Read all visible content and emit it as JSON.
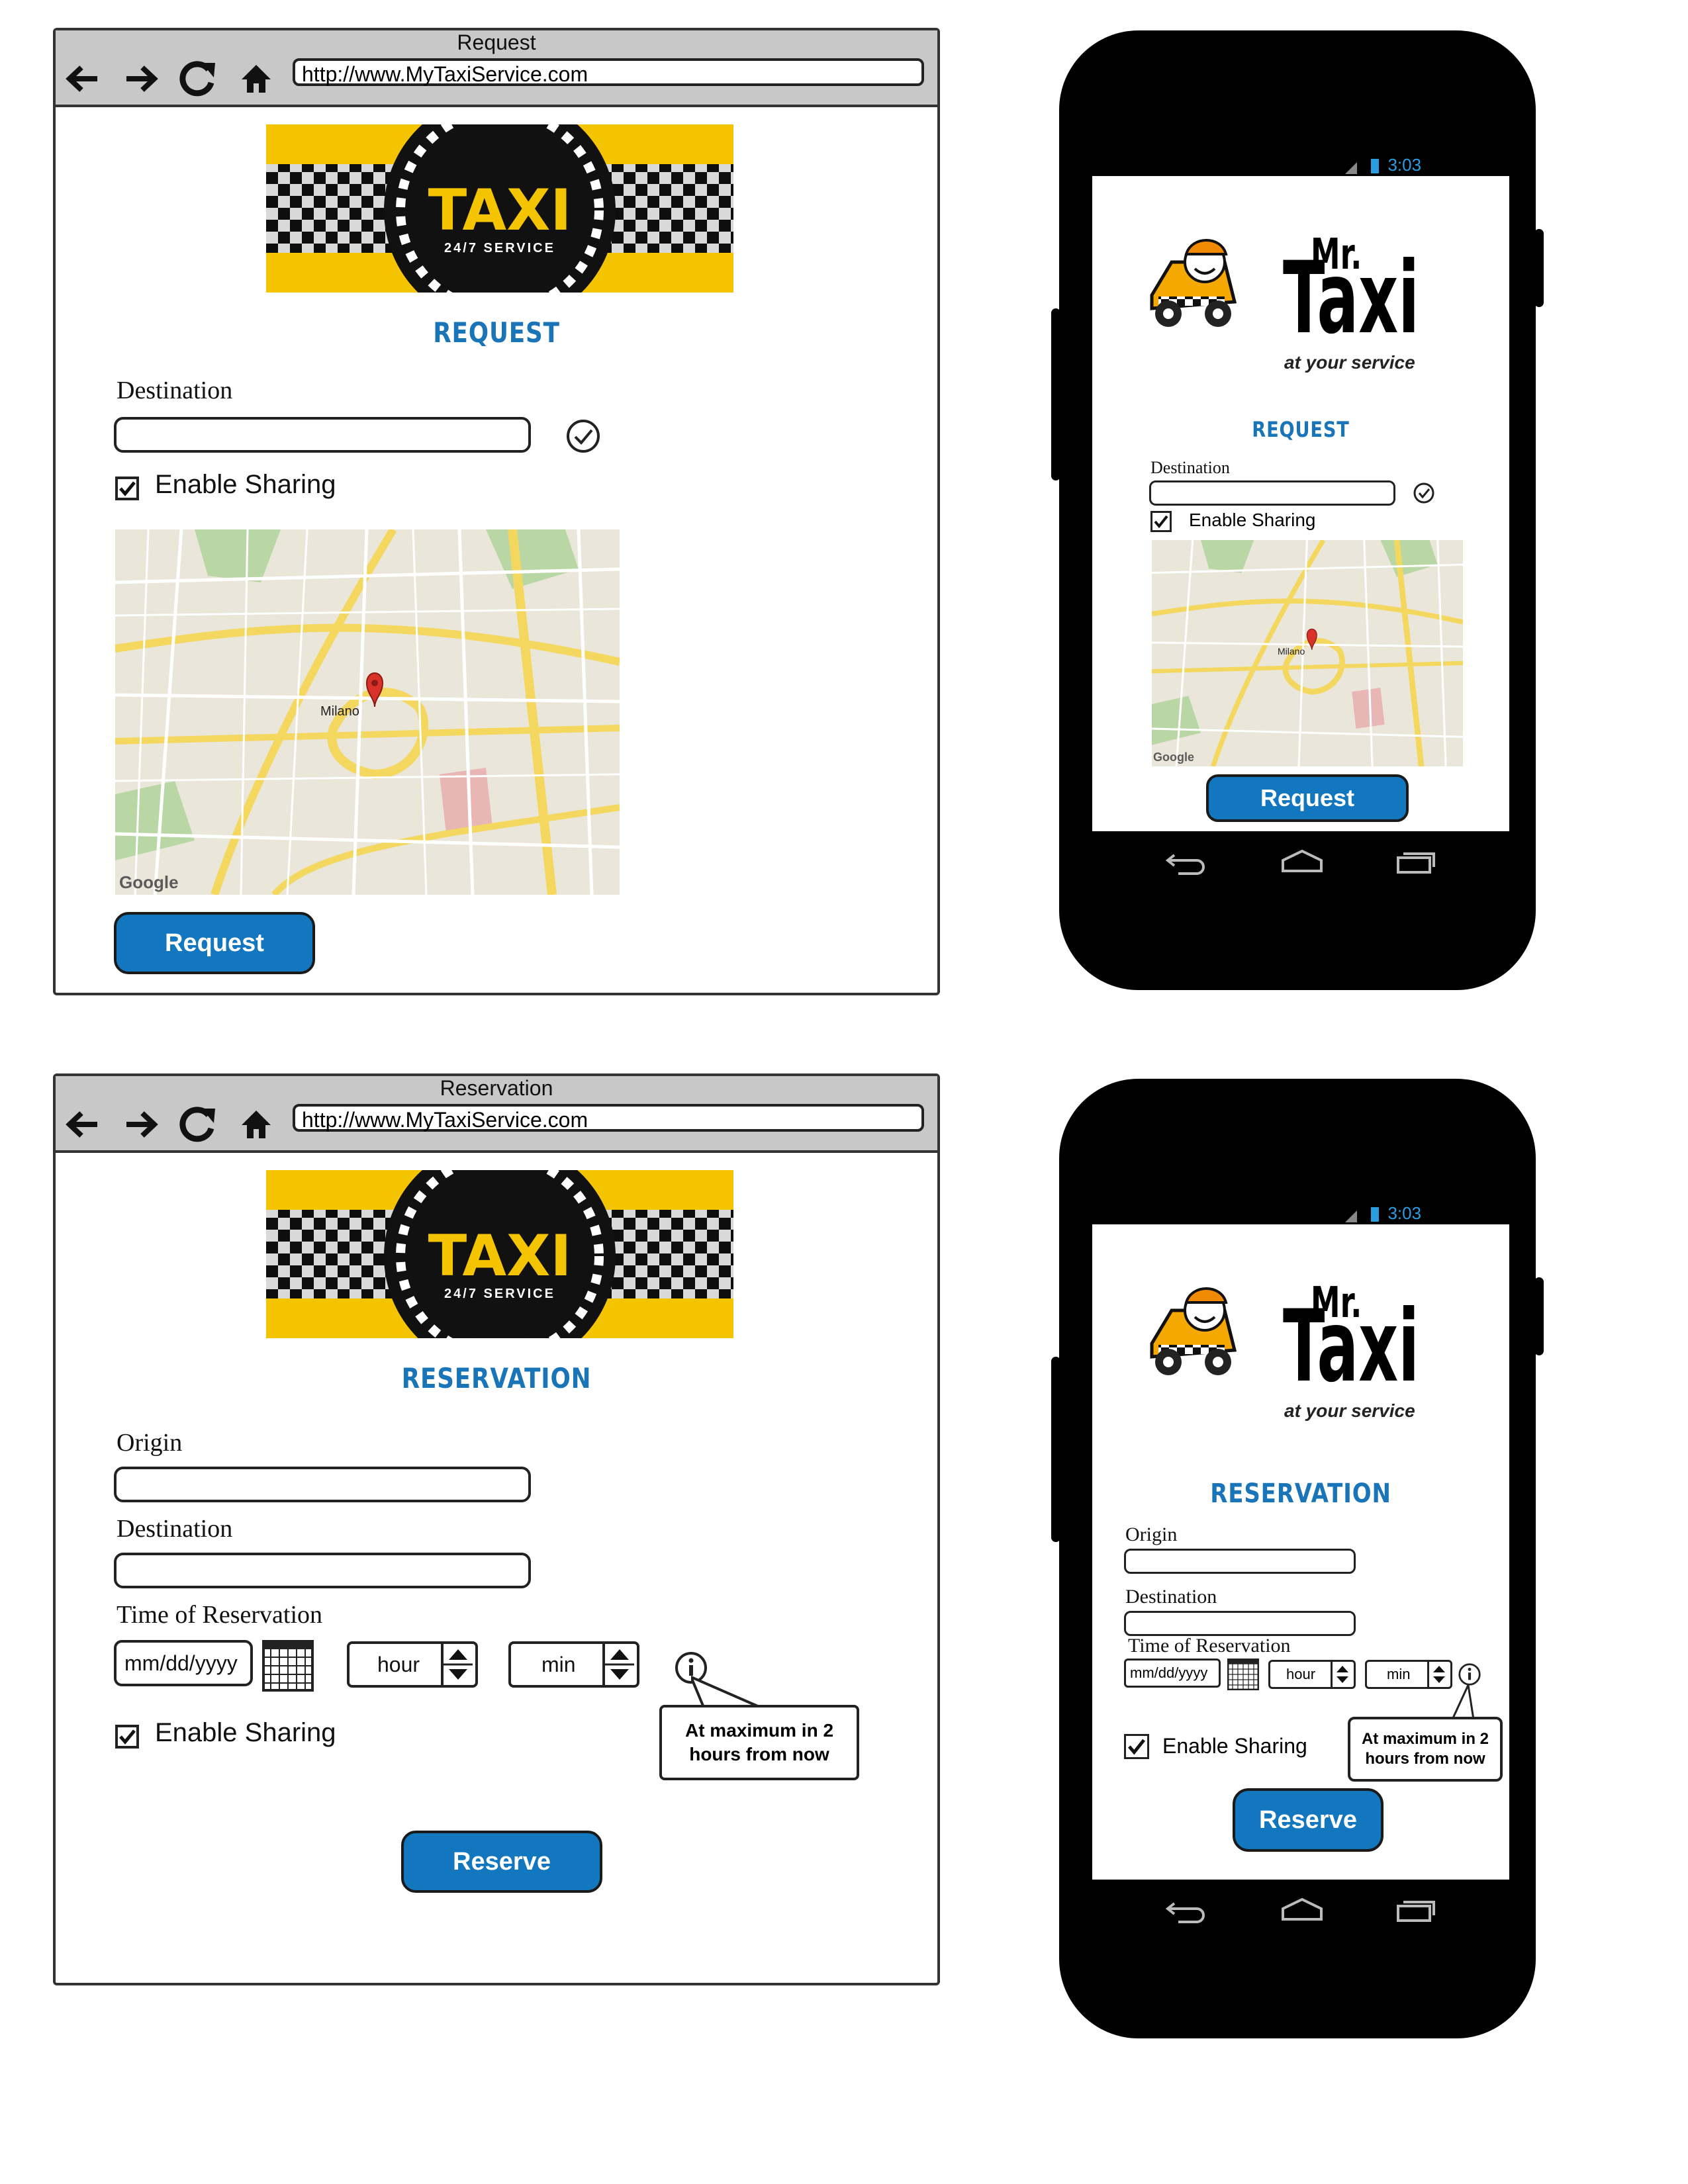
{
  "browser_request": {
    "window_title": "Request",
    "url": "http://www.MyTaxiService.com",
    "logo_text": "TAXI",
    "logo_subtext": "24/7 SERVICE",
    "heading": "REQUEST",
    "destination_label": "Destination",
    "enable_sharing_label": "Enable Sharing",
    "map_city_label": "Milano",
    "map_brand": "Google",
    "request_button": "Request"
  },
  "phone_request": {
    "status_time": "3:03",
    "logo_mr": "Mr.",
    "logo_taxi": "Taxi",
    "logo_tagline": "at your service",
    "heading": "REQUEST",
    "destination_label": "Destination",
    "enable_sharing_label": "Enable Sharing",
    "map_city_label": "Milano",
    "map_brand": "Google",
    "request_button": "Request"
  },
  "browser_reservation": {
    "window_title": "Reservation",
    "url": "http://www.MyTaxiService.com",
    "logo_text": "TAXI",
    "logo_subtext": "24/7 SERVICE",
    "heading": "RESERVATION",
    "origin_label": "Origin",
    "destination_label": "Destination",
    "time_label": "Time of Reservation",
    "date_placeholder": "mm/dd/yyyy",
    "hour_placeholder": "hour",
    "min_placeholder": "min",
    "enable_sharing_label": "Enable Sharing",
    "info_tooltip": "At maximum in 2 hours from now",
    "reserve_button": "Reserve"
  },
  "phone_reservation": {
    "status_time": "3:03",
    "logo_mr": "Mr.",
    "logo_taxi": "Taxi",
    "logo_tagline": "at your service",
    "heading": "RESERVATION",
    "origin_label": "Origin",
    "destination_label": "Destination",
    "time_label": "Time of Reservation",
    "date_placeholder": "mm/dd/yyyy",
    "hour_placeholder": "hour",
    "min_placeholder": "min",
    "enable_sharing_label": "Enable Sharing",
    "info_tooltip": "At maximum in 2 hours from now",
    "reserve_button": "Reserve"
  },
  "colors": {
    "accent_blue": "#1277bf",
    "heading_blue": "#1a75b8",
    "taxi_yellow": "#f5c400",
    "status_blue": "#2a9de0"
  }
}
